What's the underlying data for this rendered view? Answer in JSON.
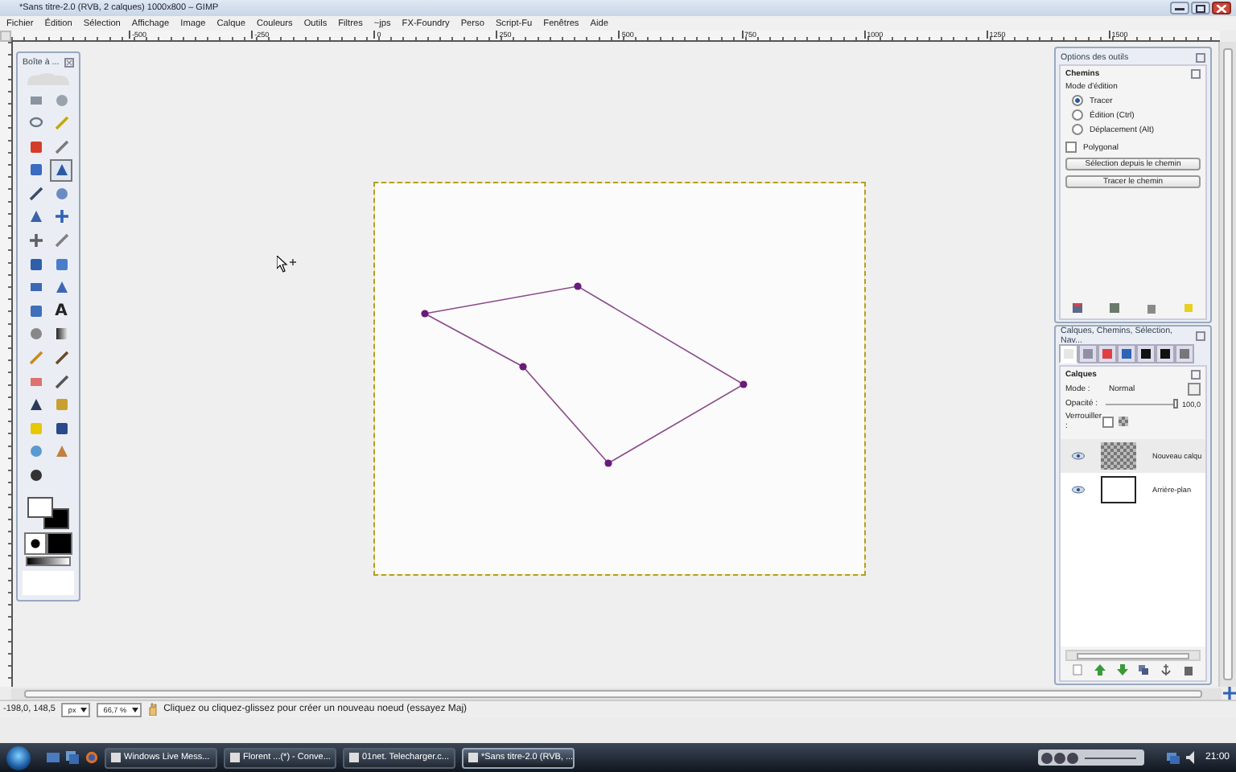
{
  "window": {
    "title": "*Sans titre-2.0 (RVB, 2 calques) 1000x800 – GIMP"
  },
  "menu": [
    "Fichier",
    "Édition",
    "Sélection",
    "Affichage",
    "Image",
    "Calque",
    "Couleurs",
    "Outils",
    "Filtres",
    "~jps",
    "FX-Foundry",
    "Perso",
    "Script-Fu",
    "Fenêtres",
    "Aide"
  ],
  "ruler_labels": [
    "-500",
    "-250",
    "0",
    "250",
    "500",
    "750",
    "1000",
    "1250",
    "1500"
  ],
  "toolbox": {
    "title": "Boîte à ...",
    "tools": [
      {
        "kind": "rect",
        "selected": false
      },
      {
        "kind": "ellipse",
        "selected": false
      },
      {
        "kind": "lasso",
        "selected": false
      },
      {
        "kind": "wand",
        "selected": false
      },
      {
        "kind": "bycolor",
        "selected": false
      },
      {
        "kind": "scissors",
        "selected": false
      },
      {
        "kind": "foreground",
        "selected": false
      },
      {
        "kind": "paths",
        "selected": true
      },
      {
        "kind": "picker",
        "selected": false
      },
      {
        "kind": "zoom",
        "selected": false
      },
      {
        "kind": "measure",
        "selected": false
      },
      {
        "kind": "move",
        "selected": false
      },
      {
        "kind": "align",
        "selected": false
      },
      {
        "kind": "crop",
        "selected": false
      },
      {
        "kind": "rotate",
        "selected": false
      },
      {
        "kind": "scale",
        "selected": false
      },
      {
        "kind": "shear",
        "selected": false
      },
      {
        "kind": "perspective",
        "selected": false
      },
      {
        "kind": "flip",
        "selected": false
      },
      {
        "kind": "text",
        "glyph": "A",
        "selected": false
      },
      {
        "kind": "hand",
        "selected": false
      },
      {
        "kind": "blend",
        "selected": false
      },
      {
        "kind": "pencil",
        "selected": false
      },
      {
        "kind": "brush",
        "selected": false
      },
      {
        "kind": "eraser",
        "selected": false
      },
      {
        "kind": "airbrush",
        "selected": false
      },
      {
        "kind": "ink",
        "selected": false
      },
      {
        "kind": "clone",
        "selected": false
      },
      {
        "kind": "heal",
        "selected": false
      },
      {
        "kind": "perspclone",
        "selected": false
      },
      {
        "kind": "blur",
        "selected": false
      },
      {
        "kind": "smudge",
        "selected": false
      },
      {
        "kind": "dodge",
        "selected": false
      }
    ]
  },
  "tool_options": {
    "title": "Options des outils",
    "tool": "Chemins",
    "mode_label": "Mode d'édition",
    "modes": [
      {
        "label": "Tracer",
        "selected": true
      },
      {
        "label": "Édition (Ctrl)",
        "selected": false
      },
      {
        "label": "Déplacement (Alt)",
        "selected": false
      }
    ],
    "polygonal": {
      "label": "Polygonal",
      "checked": false
    },
    "buttons": [
      "Sélection depuis le chemin",
      "Tracer le chemin"
    ]
  },
  "layers_dock": {
    "title": "Calques, Chemins, Sélection, Nav...",
    "tabs": [
      {
        "kind": "layers",
        "selected": true
      },
      {
        "kind": "paths",
        "selected": false
      },
      {
        "kind": "channels",
        "selected": false
      },
      {
        "kind": "navigate",
        "selected": false
      },
      {
        "kind": "corner",
        "selected": false
      },
      {
        "kind": "brush",
        "selected": false
      },
      {
        "kind": "gradient",
        "selected": false
      }
    ],
    "heading": "Calques",
    "mode_label": "Mode :",
    "mode": "Normal",
    "opacity_label": "Opacité :",
    "opacity": {
      "level": 1.0
    },
    "opacity_value": "100,0",
    "lock_label": "Verrouiller :",
    "lock": {
      "checked": false
    },
    "layers": [
      {
        "name": "Nouveau calqu",
        "kind": "transparent",
        "visible": true,
        "selected": true
      },
      {
        "name": "Arrière-plan",
        "kind": "white",
        "visible": true,
        "selected": false
      }
    ]
  },
  "status_bar": {
    "coordinates": "-198,0, 148,5",
    "unit": "px",
    "zoom": "66,7 %",
    "message": "Cliquez ou cliquez-glissez pour créer un nouveau noeud (essayez Maj)"
  },
  "taskbar": {
    "tasks": [
      {
        "label": "Windows Live Mess...",
        "selected": false
      },
      {
        "label": "Florent ...(*) - Conve...",
        "selected": false
      },
      {
        "label": "01net. Telecharger.c...",
        "selected": false
      },
      {
        "label": "*Sans titre-2.0 (RVB, ...",
        "selected": true
      }
    ],
    "clock": "21:00"
  }
}
